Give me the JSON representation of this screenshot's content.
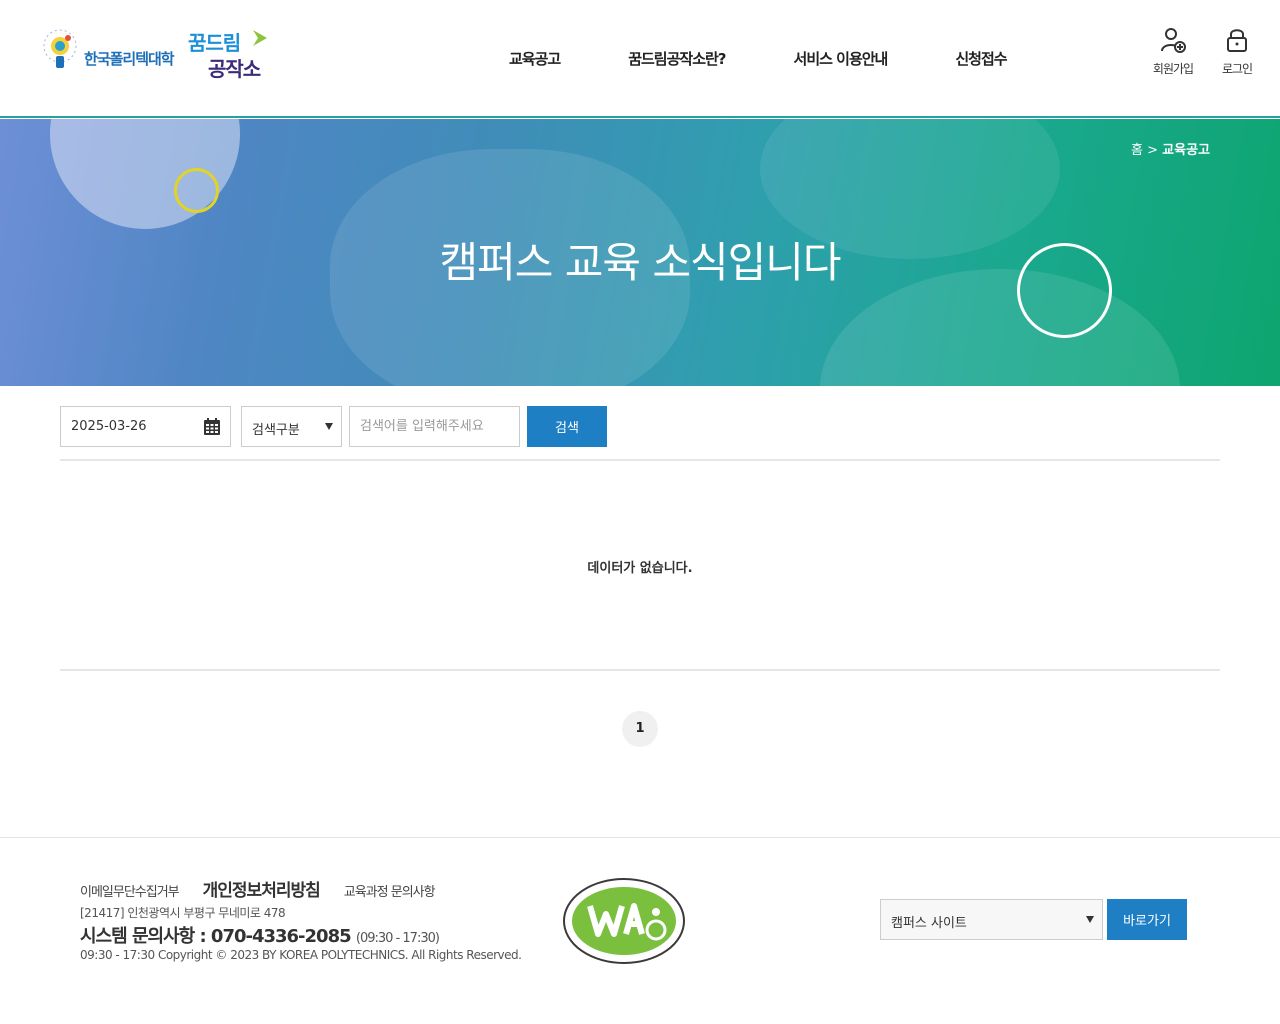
{
  "header": {
    "org_name": "한국폴리텍대학",
    "brand_line1": "꿈드림",
    "brand_line2": "공작소",
    "nav": [
      "교육공고",
      "꿈드림공작소란?",
      "서비스 이용안내",
      "신청접수"
    ],
    "signup_label": "회원가입",
    "login_label": "로그인"
  },
  "banner": {
    "title": "캠퍼스 교육 소식입니다",
    "breadcrumb_home": "홈",
    "breadcrumb_sep": ">",
    "breadcrumb_current": "교육공고"
  },
  "search": {
    "date_value": "2025-03-26",
    "type_value": "검색구분",
    "keyword_placeholder": "검색어를 입력해주세요",
    "button_label": "검색"
  },
  "list": {
    "empty_message": "데이터가 없습니다."
  },
  "pagination": {
    "current_page": "1"
  },
  "footer": {
    "link1": "이메일무단수집거부",
    "link2": "개인정보처리방침",
    "link3": "교육과정 문의사항",
    "address": "[21417] 인천광역시 부평구 무네미로 478",
    "contact_label": "시스템 문의사항 : 070-4336-2085",
    "contact_hours": "(09:30 - 17:30)",
    "copyright": "09:30 - 17:30 Copyright © 2023 BY KOREA POLYTECHNICS. All Rights Reserved.",
    "site_select_value": "캠퍼스 사이트",
    "go_label": "바로가기"
  },
  "colors": {
    "primary_button": "#1e7fc4",
    "header_border": "#2a9fa0"
  }
}
